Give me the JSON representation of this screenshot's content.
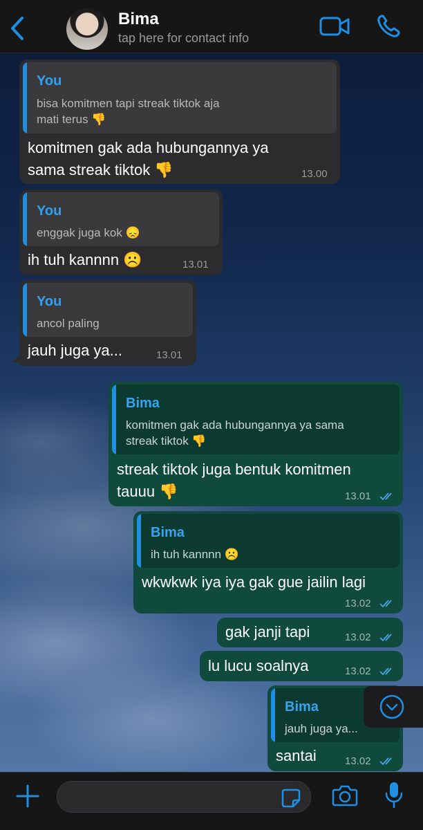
{
  "header": {
    "contact_name": "Bima",
    "subtitle": "tap here for contact info",
    "icons": {
      "back": "chevron-left-icon",
      "video": "video-camera-icon",
      "call": "phone-icon"
    }
  },
  "messages": [
    {
      "direction": "incoming",
      "quote_author": "You",
      "quote_text_line1": "bisa komitmen tapi streak tiktok aja",
      "quote_text_line2": "mati terus 👎",
      "text_line1": "komitmen gak ada hubungannya ya",
      "text_line2": "sama streak tiktok 👎",
      "time": "13.00"
    },
    {
      "direction": "incoming",
      "quote_author": "You",
      "quote_text_line1": "enggak juga kok 😞",
      "text_line1": "ih tuh kannnn ☹️",
      "time": "13.01"
    },
    {
      "direction": "incoming",
      "quote_author": "You",
      "quote_text_line1": "ancol paling",
      "text_line1": "jauh juga ya...",
      "time": "13.01"
    },
    {
      "direction": "outgoing",
      "quote_author": "Bima",
      "quote_text_line1": "komitmen gak ada hubungannya ya sama",
      "quote_text_line2": "streak tiktok 👎",
      "text_line1": "streak tiktok juga bentuk komitmen",
      "text_line2": "tauuu 👎",
      "time": "13.01",
      "status": "read"
    },
    {
      "direction": "outgoing",
      "quote_author": "Bima",
      "quote_text_line1": "ih tuh kannnn ☹️",
      "text_line1": "wkwkwk iya iya gak gue jailin lagi",
      "time": "13.02",
      "status": "read"
    },
    {
      "direction": "outgoing",
      "text_line1": "gak janji tapi",
      "time": "13.02",
      "status": "read"
    },
    {
      "direction": "outgoing",
      "text_line1": "lu lucu soalnya",
      "time": "13.02",
      "status": "read"
    },
    {
      "direction": "outgoing",
      "quote_author": "Bima",
      "quote_text_line1": "jauh juga ya...",
      "text_line1": "santai",
      "time": "13.02",
      "status": "read"
    }
  ],
  "input": {
    "placeholder": ""
  },
  "bottom_icons": [
    "plus-icon",
    "sticker-icon",
    "camera-icon",
    "microphone-icon"
  ],
  "colors": {
    "accent": "#1f8fe6",
    "incoming_bubble": "#2c2c2e",
    "outgoing_bubble": "#0f4a3c",
    "bar_background": "#161616"
  }
}
